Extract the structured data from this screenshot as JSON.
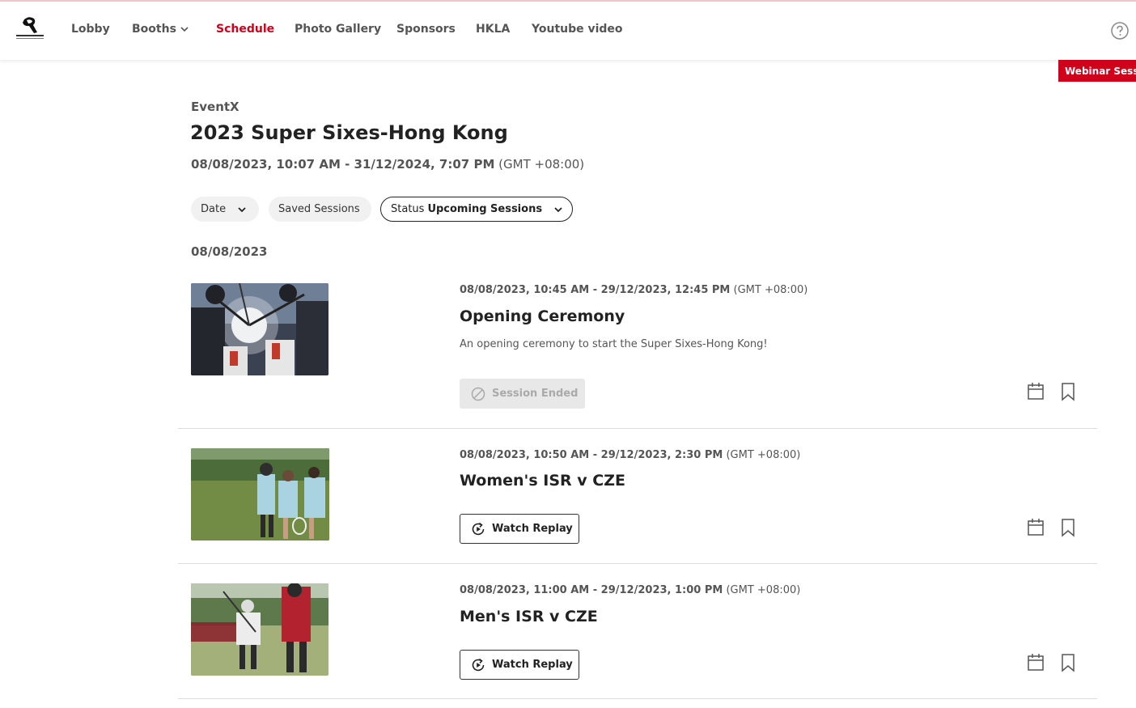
{
  "nav": {
    "items": [
      {
        "label": "Lobby",
        "active": false
      },
      {
        "label": "Booths",
        "active": false,
        "has_dropdown": true
      },
      {
        "label": "Schedule",
        "active": true
      },
      {
        "label": "Photo Gallery",
        "active": false
      },
      {
        "label": "Sponsors",
        "active": false
      },
      {
        "label": "HKLA",
        "active": false
      },
      {
        "label": "Youtube video",
        "active": false
      }
    ],
    "help_icon": "help-circle-icon"
  },
  "webinar_tab": "Webinar Session",
  "event": {
    "organizer": "EventX",
    "title": "2023 Super Sixes-Hong Kong",
    "date_range": "08/08/2023, 10:07 AM - 31/12/2024, 7:07 PM",
    "timezone": "(GMT +08:00)"
  },
  "filters": {
    "date_label": "Date",
    "saved_label": "Saved Sessions",
    "status_label": "Status",
    "status_value": "Upcoming Sessions"
  },
  "date_heading": "08/08/2023",
  "sessions": [
    {
      "time": "08/08/2023, 10:45 AM - 29/12/2023, 12:45 PM",
      "timezone": "(GMT +08:00)",
      "title": "Opening Ceremony",
      "description": "An opening ceremony to start the Super Sixes-Hong Kong!",
      "action": "Session Ended",
      "action_state": "ended"
    },
    {
      "time": "08/08/2023, 10:50 AM - 29/12/2023, 2:30 PM",
      "timezone": "(GMT +08:00)",
      "title": "Women's ISR v CZE",
      "action": "Watch Replay",
      "action_state": "replay"
    },
    {
      "time": "08/08/2023, 11:00 AM - 29/12/2023, 1:00 PM",
      "timezone": "(GMT +08:00)",
      "title": "Men's ISR v CZE",
      "action": "Watch Replay",
      "action_state": "replay"
    }
  ],
  "colors": {
    "accent": "#d0021b",
    "text_primary": "#222222",
    "text_secondary": "#555555",
    "divider": "#dcdcdc"
  }
}
